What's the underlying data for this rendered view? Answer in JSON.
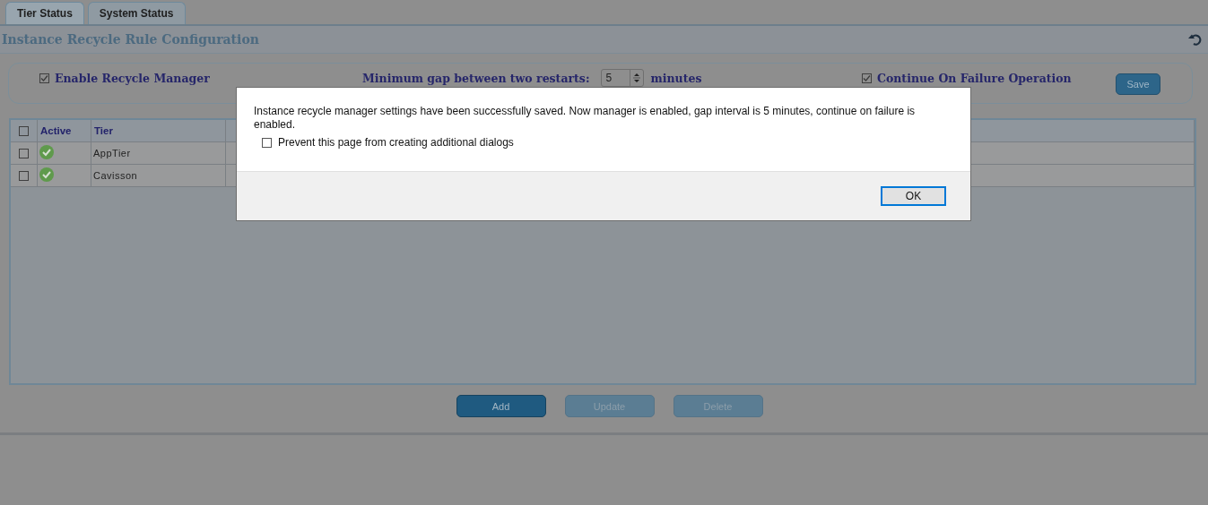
{
  "tabs": [
    {
      "label": "Tier Status",
      "selected": true
    },
    {
      "label": "System Status",
      "selected": false
    }
  ],
  "title": "Instance Recycle Rule Configuration",
  "settings": {
    "enable_recycle_manager": {
      "label": "Enable Recycle Manager",
      "checked": true
    },
    "minimum_gap": {
      "label": "Minimum gap between two restarts:",
      "value": "5",
      "unit": "minutes"
    },
    "continue_on_failure": {
      "label": "Continue On Failure Operation",
      "checked": true
    },
    "save_button": "Save"
  },
  "table": {
    "select_all": {
      "checked": false
    },
    "columns": [
      "Active",
      "Tier"
    ],
    "rows": [
      {
        "checked": false,
        "active": true,
        "tier": "AppTier"
      },
      {
        "checked": false,
        "active": true,
        "tier": "Cavisson"
      }
    ]
  },
  "actions": [
    {
      "label": "Add",
      "disabled": false
    },
    {
      "label": "Update",
      "disabled": true
    },
    {
      "label": "Delete",
      "disabled": true
    }
  ],
  "dialog": {
    "message": "Instance recycle manager settings have been successfully saved. Now  manager is enabled, gap interval is 5 minutes, continue on failure is enabled.",
    "prevent_dialogs": {
      "label": "Prevent this page from creating additional dialogs",
      "checked": false
    },
    "ok_button": "OK"
  }
}
